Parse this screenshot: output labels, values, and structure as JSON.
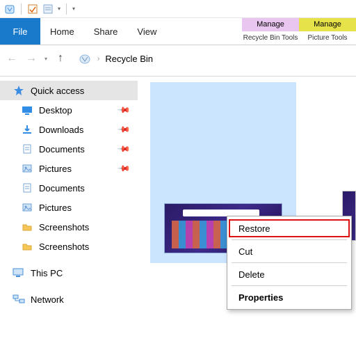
{
  "qat": {
    "dropdown_glyph": "▾"
  },
  "ribbon": {
    "file": "File",
    "tabs": [
      "Home",
      "Share",
      "View"
    ],
    "context": [
      {
        "title": "Manage",
        "sub": "Recycle Bin Tools"
      },
      {
        "title": "Manage",
        "sub": "Picture Tools"
      }
    ]
  },
  "breadcrumb": {
    "location": "Recycle Bin",
    "sep": "›"
  },
  "sidebar": {
    "items": [
      {
        "label": "Quick access",
        "icon": "star",
        "selected": true
      },
      {
        "label": "Desktop",
        "icon": "desktop",
        "pinned": true,
        "indent": true
      },
      {
        "label": "Downloads",
        "icon": "download",
        "pinned": true,
        "indent": true
      },
      {
        "label": "Documents",
        "icon": "document",
        "pinned": true,
        "indent": true
      },
      {
        "label": "Pictures",
        "icon": "pictures",
        "pinned": true,
        "indent": true
      },
      {
        "label": "Documents",
        "icon": "document",
        "indent": true
      },
      {
        "label": "Pictures",
        "icon": "pictures",
        "indent": true
      },
      {
        "label": "Screenshots",
        "icon": "folder",
        "indent": true
      },
      {
        "label": "Screenshots",
        "icon": "folder",
        "indent": true
      },
      {
        "label": "This PC",
        "icon": "thispc",
        "top": true
      },
      {
        "label": "Network",
        "icon": "network",
        "top": true
      }
    ]
  },
  "context_menu": {
    "items": [
      {
        "label": "Restore",
        "highlight": true
      },
      {
        "sep": true
      },
      {
        "label": "Cut"
      },
      {
        "sep": true
      },
      {
        "label": "Delete"
      },
      {
        "sep": true
      },
      {
        "label": "Properties",
        "bold": true
      }
    ]
  }
}
